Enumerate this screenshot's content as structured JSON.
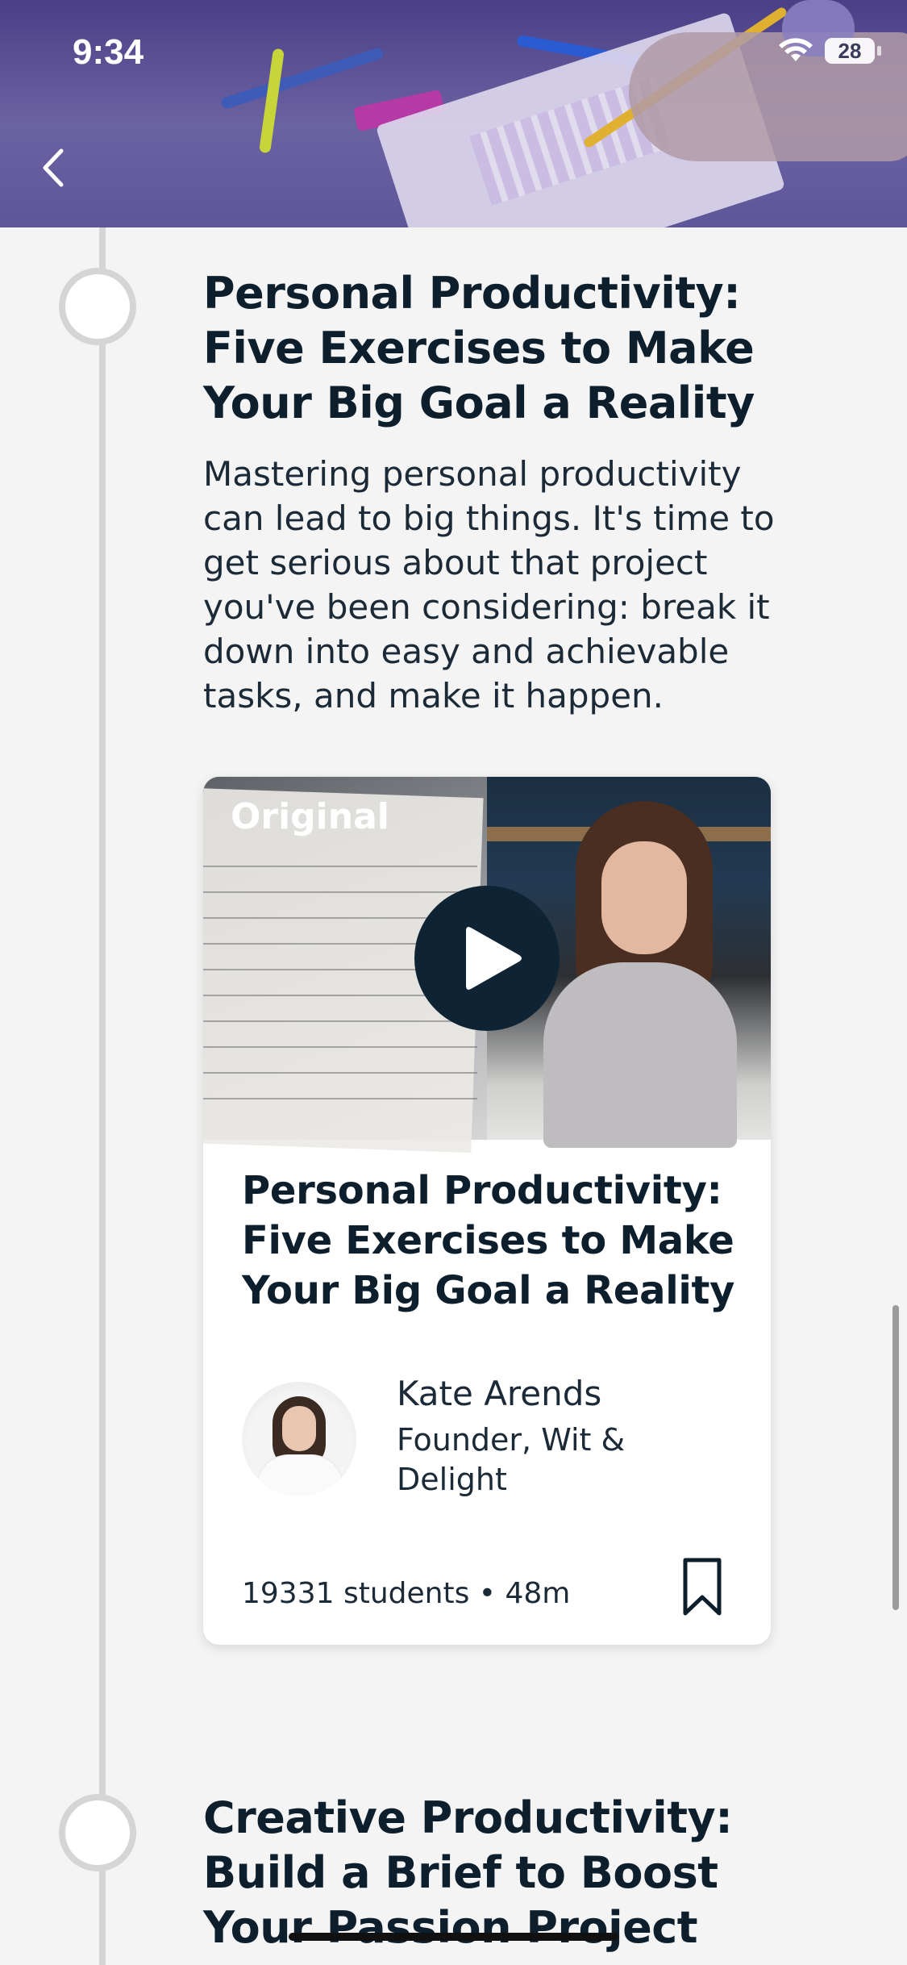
{
  "status_bar": {
    "time": "9:34",
    "battery": "28"
  },
  "sections": [
    {
      "title": "Personal Productivity: Five Exercises to Make Your Big Goal a Reality",
      "description": "Mastering personal productivity can lead to big things. It's time to get serious about that project you've been considering: break it down into easy and achievable tasks, and make it happen."
    },
    {
      "title": "Creative Productivity: Build a Brief to Boost Your Passion Project"
    }
  ],
  "card": {
    "badge": "Original",
    "title": "Personal Productivity: Five Exercises to Make Your Big Goal a Reality",
    "instructor": {
      "name": "Kate Arends",
      "role": "Founder, Wit & Delight"
    },
    "meta": "19331 students • 48m"
  },
  "icons": {
    "back": "chevron-left-icon",
    "play": "play-icon",
    "bookmark": "bookmark-icon",
    "wifi": "wifi-icon",
    "battery": "battery-icon"
  }
}
